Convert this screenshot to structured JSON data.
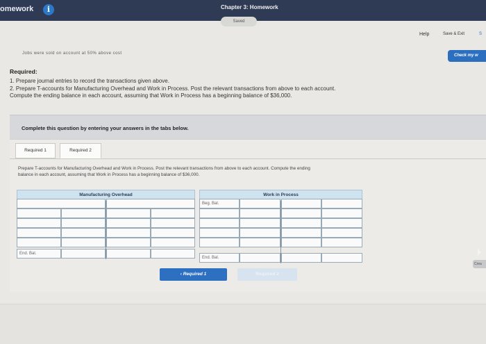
{
  "topbar": {
    "app_title": "omework",
    "info_icon_glyph": "i",
    "chapter_title": "Chapter 3: Homework"
  },
  "status": {
    "saved_label": "Saved"
  },
  "header_actions": {
    "help_label": "Help",
    "save_exit_label": "Save & Exit",
    "submit_label_cut": "S",
    "check_label": "Check my w"
  },
  "question": {
    "cutoff_text": "Jobs were sold on account at 50% above cost",
    "required_heading": "Required:",
    "required_lines": [
      "1. Prepare journal entries to record the transactions given above.",
      "2. Prepare T-accounts for Manufacturing Overhead and Work in Process. Post the relevant transactions from above to each account.",
      "Compute the ending balance in each account, assuming that Work in Process has a beginning balance of $36,000."
    ]
  },
  "instructions_bar": {
    "text": "Complete this question by entering your answers in the tabs below."
  },
  "tabs": [
    {
      "label": "Required 1",
      "active": false
    },
    {
      "label": "Required 2",
      "active": true
    }
  ],
  "tab_instructions": [
    "Prepare T-accounts for Manufacturing Overhead and Work in Process. Post the relevant transactions from above to each account. Compute the ending",
    "balance in each account, assuming that Work in Process has a beginning balance of $36,000."
  ],
  "t_accounts": {
    "overhead": {
      "title": "Manufacturing Overhead",
      "end_label": "End. Bal."
    },
    "wip": {
      "title": "Work in Process",
      "beg_label": "Beg. Bal.",
      "end_label": "End. Bal."
    }
  },
  "navigation": {
    "prev_label": "Required 1",
    "next_label": "Required 2",
    "prev_arrow": "‹"
  },
  "edge": {
    "tab_label": "Crea"
  },
  "colors": {
    "topbar": "#2f3a55",
    "accent": "#2d6fc0",
    "t_header": "#cfe2f0",
    "cell_border": "#98a9b8"
  }
}
